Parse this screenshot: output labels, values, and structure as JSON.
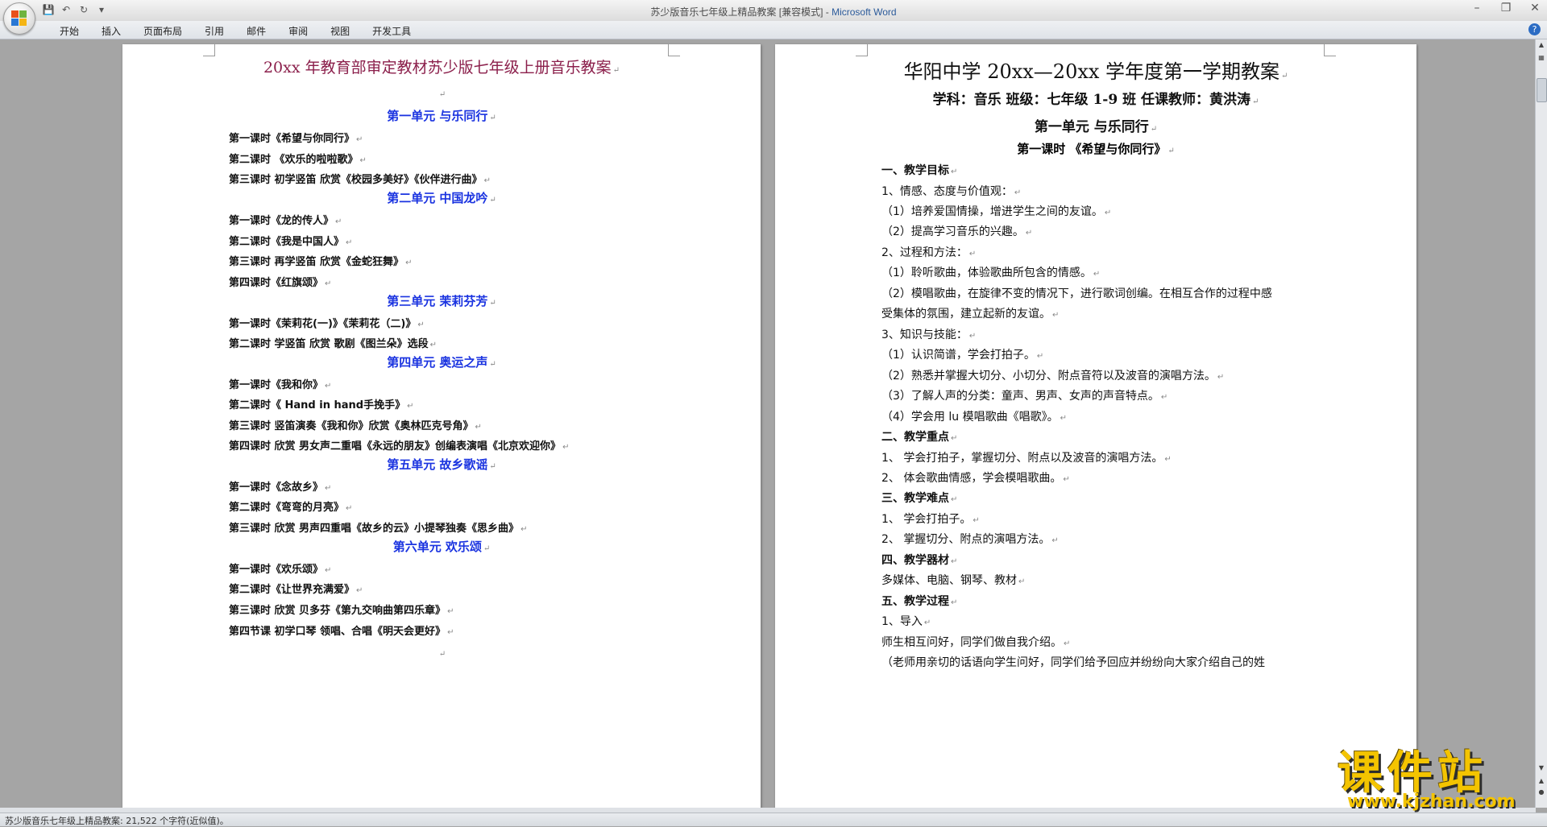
{
  "window": {
    "title": "苏少版音乐七年级上精品教案 [兼容模式] - ",
    "app_name": "Microsoft Word"
  },
  "ribbon": {
    "tabs": [
      "开始",
      "插入",
      "页面布局",
      "引用",
      "邮件",
      "审阅",
      "视图",
      "开发工具"
    ]
  },
  "left_page": {
    "title": "20xx 年教育部审定教材苏少版七年级上册音乐教案",
    "units": [
      {
        "heading": "第一单元    与乐同行",
        "lessons": [
          "第一课时《希望与你同行》",
          "第二课时  《欢乐的啦啦歌》",
          "第三课时 初学竖笛 欣赏《校园多美好》《伙伴进行曲》"
        ]
      },
      {
        "heading": "第二单元      中国龙吟",
        "lessons": [
          "第一课时《龙的传人》",
          "第二课时《我是中国人》",
          "第三课时 再学竖笛 欣赏《金蛇狂舞》",
          "第四课时《红旗颂》"
        ]
      },
      {
        "heading": "第三单元    茉莉芬芳",
        "lessons": [
          "第一课时《茉莉花(一)》《茉莉花（二)》",
          "第二课时 学竖笛 欣赏 歌剧《图兰朵》选段"
        ]
      },
      {
        "heading": "第四单元    奥运之声",
        "lessons": [
          "第一课时《我和你》",
          "第二课时《 Hand in hand手挽手》",
          "第三课时 竖笛演奏《我和你》欣赏《奥林匹克号角》",
          "第四课时 欣赏 男女声二重唱《永远的朋友》创编表演唱《北京欢迎你》"
        ]
      },
      {
        "heading": "第五单元    故乡歌谣",
        "lessons": [
          "第一课时《念故乡》",
          "第二课时《弯弯的月亮》",
          "第三课时  欣赏 男声四重唱《故乡的云》小提琴独奏《思乡曲》"
        ]
      },
      {
        "heading": "第六单元  欢乐颂",
        "lessons": [
          "第一课时《欢乐颂》",
          "第二课时《让世界充满爱》",
          "第三课时 欣赏 贝多芬《第九交响曲第四乐章》",
          "第四节课 初学口琴 领唱、合唱《明天会更好》"
        ]
      }
    ]
  },
  "right_page": {
    "title": "华阳中学 20xx—20xx 学年度第一学期教案",
    "subtitle": "学科：音乐     班级：七年级 1-9 班     任课教师：黄洪涛",
    "unit_heading": "第一单元     与乐同行",
    "lesson_heading": "第一课时 《希望与你同行》",
    "lines": [
      {
        "text": "一、教学目标",
        "bold": true
      },
      {
        "text": "1、情感、态度与价值观：",
        "bold": false
      },
      {
        "text": "（1）培养爱国情操，增进学生之间的友谊。",
        "bold": false
      },
      {
        "text": "（2）提高学习音乐的兴趣。",
        "bold": false
      },
      {
        "text": "2、过程和方法：",
        "bold": false
      },
      {
        "text": "（1）聆听歌曲，体验歌曲所包含的情感。",
        "bold": false
      },
      {
        "text": "（2）模唱歌曲，在旋律不变的情况下，进行歌词创编。在相互合作的过程中感",
        "bold": false
      },
      {
        "text": "受集体的氛围，建立起新的友谊。",
        "bold": false
      },
      {
        "text": "3、知识与技能：",
        "bold": false
      },
      {
        "text": "（1）认识简谱，学会打拍子。",
        "bold": false
      },
      {
        "text": "（2）熟悉并掌握大切分、小切分、附点音符以及波音的演唱方法。",
        "bold": false
      },
      {
        "text": "（3）了解人声的分类：童声、男声、女声的声音特点。",
        "bold": false
      },
      {
        "text": "（4）学会用 lu 模唱歌曲《唱歌》。",
        "bold": false
      },
      {
        "text": "二、教学重点",
        "bold": true
      },
      {
        "text": "1、 学会打拍子，掌握切分、附点以及波音的演唱方法。",
        "bold": false
      },
      {
        "text": "2、 体会歌曲情感，学会模唱歌曲。",
        "bold": false
      },
      {
        "text": "三、教学难点",
        "bold": true
      },
      {
        "text": "1、 学会打拍子。",
        "bold": false
      },
      {
        "text": "2、 掌握切分、附点的演唱方法。",
        "bold": false
      },
      {
        "text": "四、教学器材",
        "bold": true
      },
      {
        "text": "多媒体、电脑、钢琴、教材",
        "bold": false
      },
      {
        "text": "五、教学过程",
        "bold": true
      },
      {
        "text": "1、导入",
        "bold": false
      },
      {
        "text": "师生相互问好，同学们做自我介绍。",
        "bold": false
      },
      {
        "text": "（老师用亲切的话语向学生问好，同学们给予回应并纷纷向大家介绍自己的姓",
        "bold": false
      }
    ]
  },
  "status": {
    "text": "苏少版音乐七年级上精品教案: 21,522 个字符(近似值)。"
  },
  "watermark": {
    "main": "课件站",
    "url": "www.kjzhan.com"
  },
  "colors": {
    "left_title": "#8b1f4b",
    "unit_heading": "#1a33e0",
    "watermark": "#f4c400"
  }
}
